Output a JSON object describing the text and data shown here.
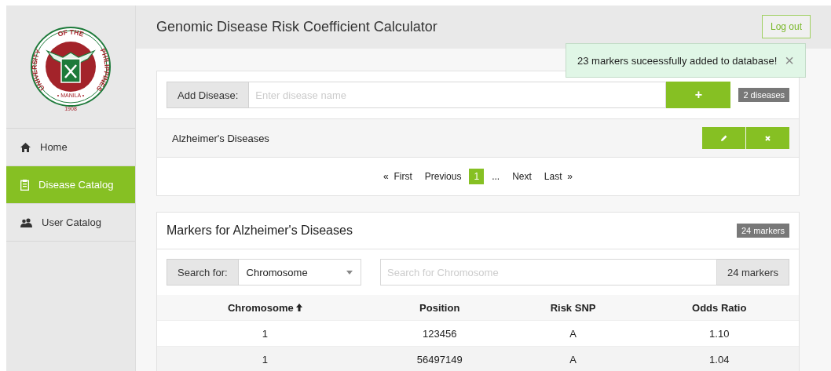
{
  "sidebar": {
    "seal": {
      "left_text": "UNIVERSITY",
      "top_text": "OF THE",
      "right_text": "PHILIPPINES",
      "bottom_text": "• MANILA •",
      "year": "1908"
    },
    "items": [
      {
        "label": "Home",
        "selected": false
      },
      {
        "label": "Disease Catalog",
        "selected": true
      },
      {
        "label": "User Catalog",
        "selected": false
      }
    ]
  },
  "header": {
    "title": "Genomic Disease Risk Coefficient Calculator",
    "logout": "Log out"
  },
  "alert": {
    "message": "23 markers suceessfully added to database!",
    "close": "×"
  },
  "add_disease": {
    "label": "Add Disease:",
    "placeholder": "Enter disease name",
    "button": "+",
    "count": "2 diseases"
  },
  "diseases": [
    {
      "name": "Alzheimer's Diseases"
    }
  ],
  "pagination": [
    {
      "label": "«  First",
      "selected": false
    },
    {
      "label": "Previous",
      "selected": false
    },
    {
      "label": "1",
      "selected": true
    },
    {
      "label": "...",
      "selected": false
    },
    {
      "label": "Next",
      "selected": false
    },
    {
      "label": "Last  »",
      "selected": false
    }
  ],
  "markers": {
    "title": "Markers for Alzheimer's Diseases",
    "badge": "24 markers",
    "search_label": "Search for:",
    "search_by": "Chromosome",
    "search_placeholder": "Search for Chromosome",
    "count": "24 markers"
  },
  "table": {
    "columns": [
      {
        "label": "Chromosome",
        "sorted": true
      },
      {
        "label": "Position",
        "sorted": false
      },
      {
        "label": "Risk SNP",
        "sorted": false
      },
      {
        "label": "Odds Ratio",
        "sorted": false
      }
    ],
    "rows": [
      [
        "1",
        "123456",
        "A",
        "1.10"
      ],
      [
        "1",
        "56497149",
        "A",
        "1.04"
      ]
    ]
  }
}
